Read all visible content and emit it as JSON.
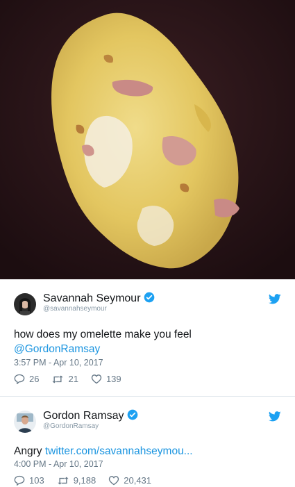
{
  "tweets": [
    {
      "name": "Savannah Seymour",
      "handle": "@savannahseymour",
      "text": "how does my omelette make you feel",
      "mention": "@GordonRamsay",
      "time": "3:57 PM - Apr 10, 2017",
      "replies": "26",
      "retweets": "21",
      "likes": "139"
    },
    {
      "name": "Gordon Ramsay",
      "handle": "@GordonRamsay",
      "text": "Angry",
      "link": "twitter.com/savannahseymou...",
      "time": "4:00 PM - Apr 10, 2017",
      "replies": "103",
      "retweets": "9,188",
      "likes": "20,431"
    }
  ],
  "colors": {
    "link": "#1b95e0",
    "verified": "#1da1f2",
    "muted": "#657786",
    "photo_background": "#2a1619",
    "omelette": "#e3c660"
  },
  "icons": [
    "verified-badge-icon",
    "twitter-bird-icon",
    "reply-icon",
    "retweet-icon",
    "like-icon"
  ]
}
